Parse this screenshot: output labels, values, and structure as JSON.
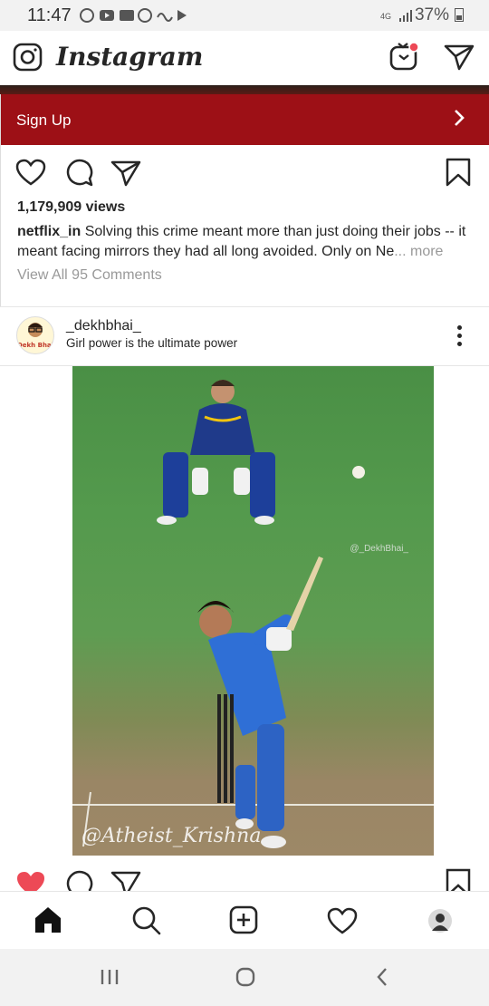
{
  "status_bar": {
    "time": "11:47",
    "signal": "4G",
    "battery": "37%"
  },
  "header": {
    "logo": "Instagram",
    "icons": [
      "camera-icon",
      "igtv-icon",
      "direct-message-icon"
    ]
  },
  "ad": {
    "cta_label": "Sign Up",
    "cta_color": "#9d1016"
  },
  "post1": {
    "views": "1,179,909 views",
    "username": "netflix_in",
    "caption": "Solving this crime meant more than just doing their jobs -- it meant facing mirrors they had all long avoided. Only on Ne",
    "more": "... more",
    "comments": "View All 95 Comments"
  },
  "post2": {
    "username": "_dekhbhai_",
    "subtitle": "Girl power is the ultimate power",
    "avatar_text": "Dekh Bhai",
    "photo_watermark": "@_DekhBhai_",
    "photo_signature": "@Atheist_Krishna",
    "liked": true,
    "like_color": "#ed4956"
  },
  "bottom_nav": {
    "items": [
      "home-icon",
      "search-icon",
      "new-post-icon",
      "activity-icon",
      "profile-avatar"
    ]
  },
  "system_nav": {
    "items": [
      "recents-icon",
      "home-circle-icon",
      "back-icon"
    ]
  }
}
